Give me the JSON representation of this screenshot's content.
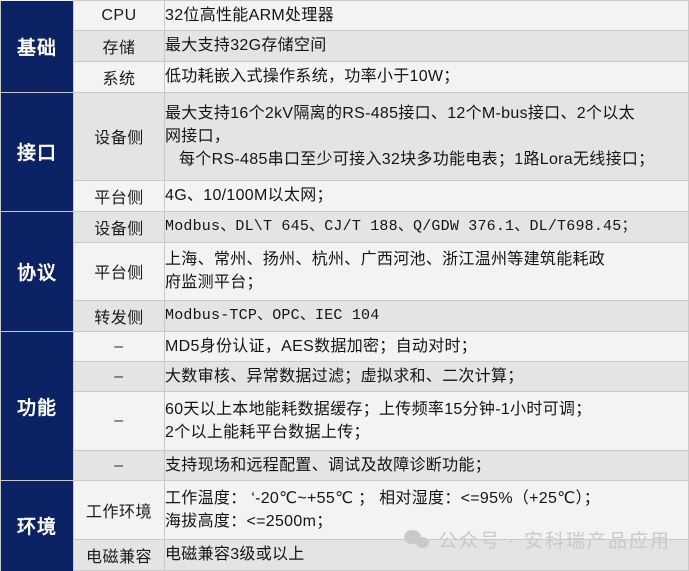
{
  "colors": {
    "category_bg": "#0b2264",
    "category_text": "#ffffff",
    "row_shade": "#e4e4e4",
    "row_light": "#f3f3f3",
    "grid_line": "#c9c9c9",
    "watermark": "#c9c9c9"
  },
  "watermark": {
    "icon": "wechat-logo-icon",
    "text": "公众号 · 安科瑞产品应用"
  },
  "table": {
    "sections": [
      {
        "category": "基础",
        "rows": [
          {
            "sub": "CPU",
            "lines": [
              "32位高性能ARM处理器"
            ]
          },
          {
            "sub": "存储",
            "lines": [
              "最大支持32G存储空间"
            ]
          },
          {
            "sub": "系统",
            "lines": [
              "低功耗嵌入式操作系统，功率小于10W；"
            ]
          }
        ]
      },
      {
        "category": "接口",
        "rows": [
          {
            "sub": "设备侧",
            "lines": [
              "最大支持16个2kV隔离的RS-485接口、12个M-bus接口、2个以太",
              "网接口，",
              "每个RS-485串口至少可接入32块多功能电表；1路Lora无线接口；"
            ],
            "indent_lines": [
              2
            ]
          },
          {
            "sub": "平台侧",
            "lines": [
              "4G、10/100M以太网；"
            ]
          }
        ]
      },
      {
        "category": "协议",
        "rows": [
          {
            "sub": "设备侧",
            "mono": true,
            "lines": [
              "Modbus、DL\\T 645、CJ/T 188、Q/GDW 376.1、DL/T698.45；"
            ]
          },
          {
            "sub": "平台侧",
            "lines": [
              "上海、常州、扬州、杭州、广西河池、浙江温州等建筑能耗政",
              "府监测平台；"
            ]
          },
          {
            "sub": "转发侧",
            "mono": true,
            "lines": [
              "Modbus-TCP、OPC、IEC 104"
            ]
          }
        ]
      },
      {
        "category": "功能",
        "rows": [
          {
            "sub": "–",
            "lines": [
              "MD5身份认证，AES数据加密；自动对时；"
            ]
          },
          {
            "sub": "–",
            "lines": [
              "大数审核、异常数据过滤；虚拟求和、二次计算；"
            ]
          },
          {
            "sub": "–",
            "lines": [
              "60天以上本地能耗数据缓存；上传频率15分钟-1小时可调；",
              "2个以上能耗平台数据上传；"
            ]
          },
          {
            "sub": "–",
            "lines": [
              "支持现场和远程配置、调试及故障诊断功能；"
            ]
          }
        ]
      },
      {
        "category": "环境",
        "rows": [
          {
            "sub": "工作环境",
            "lines": [
              "工作温度： ‘-20℃~+55℃ ； 相对湿度：<=95%（+25℃）；",
              "海拔高度：<=2500m；"
            ]
          },
          {
            "sub": "电磁兼容",
            "lines": [
              "电磁兼容3级或以上"
            ]
          }
        ]
      }
    ]
  }
}
